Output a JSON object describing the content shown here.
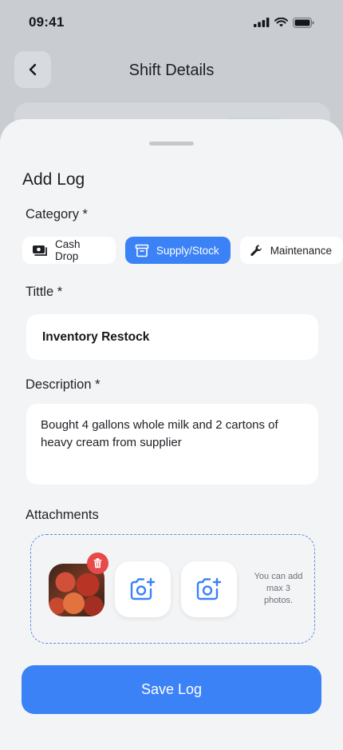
{
  "status_bar": {
    "time": "09:41",
    "icons": [
      "signal-icon",
      "wifi-icon",
      "battery-icon"
    ]
  },
  "header": {
    "title": "Shift Details",
    "back_icon": "chevron-left-icon"
  },
  "sheet": {
    "title": "Add Log",
    "category": {
      "label": "Category *",
      "options": [
        {
          "label": "Cash Drop",
          "icon": "cash-icon",
          "selected": false
        },
        {
          "label": "Supply/Stock",
          "icon": "archive-box-icon",
          "selected": true
        },
        {
          "label": "Maintenance",
          "icon": "wrench-icon",
          "selected": false
        }
      ]
    },
    "title_field": {
      "label": "Tittle *",
      "value": "Inventory Restock"
    },
    "description_field": {
      "label": "Description *",
      "value": "Bought 4 gallons whole milk and 2 cartons of heavy cream from supplier"
    },
    "attachments": {
      "label": "Attachments",
      "photo_count": 1,
      "hint": "You can add max 3 photos."
    },
    "save_label": "Save Log"
  },
  "colors": {
    "accent": "#3B82F6",
    "delete": "#E84949",
    "sheet_bg": "#F3F4F6",
    "overlay_bg": "#C9CCD1"
  }
}
